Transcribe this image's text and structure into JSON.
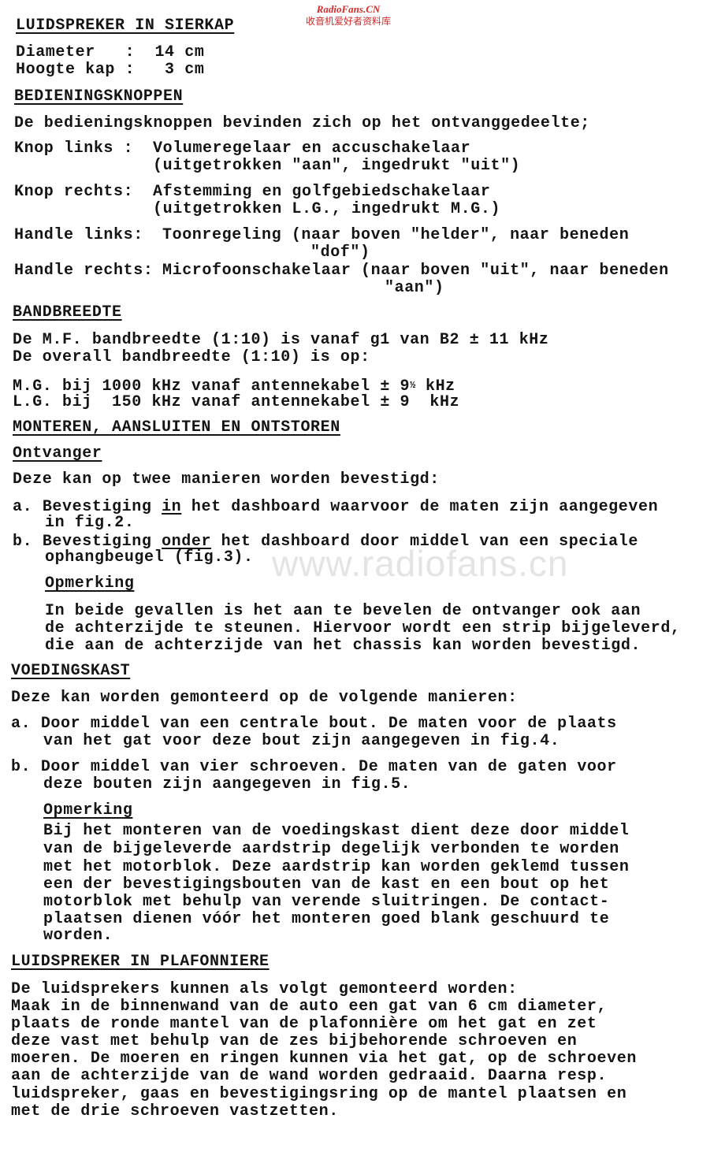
{
  "watermark": {
    "site_en": "RadioFans.CN",
    "site_cn": "收音机爱好者资料库",
    "center_url": "www.radiofans.cn"
  },
  "sections": {
    "sierkap": {
      "heading": "LUIDSPREKER IN SIERKAP",
      "specs": [
        {
          "label": "Diameter   :",
          "value": "14",
          "unit": "cm"
        },
        {
          "label": "Hoogte kap :",
          "value": " 3",
          "unit": "cm"
        }
      ]
    },
    "bediening": {
      "heading": "BEDIENINGSKNOPPEN",
      "intro": "De bedieningsknoppen bevinden zich op het ontvanggedeelte;",
      "controls": [
        {
          "label": "Knop links :",
          "line1": "Volumeregelaar en accuschakelaar",
          "line2": "(uitgetrokken \"aan\", ingedrukt \"uit\")"
        },
        {
          "label": "Knop rechts:",
          "line1": "Afstemming en golfgebiedschakelaar",
          "line2": "(uitgetrokken L.G., ingedrukt M.G.)"
        },
        {
          "label": "Handle links:",
          "line1": "Toonregeling (naar boven \"helder\", naar beneden",
          "line2": "\"dof\")"
        },
        {
          "label": "Handle rechts:",
          "line1": "Microfoonschakelaar (naar boven \"uit\", naar beneden",
          "line2": "\"aan\")"
        }
      ]
    },
    "bandbreedte": {
      "heading": "BANDBREEDTE",
      "line1": "De M.F. bandbreedte (1:10) is vanaf g1 van B2 ± 11 kHz",
      "line2": "De overall bandbreedte (1:10) is op:",
      "rows": [
        {
          "band": "M.G. bij",
          "freq": "1000 kHz",
          "text": "vanaf antennekabel",
          "pm": "±",
          "value": "9",
          "frac": "½",
          "unit": "kHz"
        },
        {
          "band": "L.G. bij",
          "freq": " 150 kHz",
          "text": "vanaf antennekabel",
          "pm": "±",
          "value": "9",
          "frac": "",
          "unit": " kHz"
        }
      ]
    },
    "monteren": {
      "heading": "MONTEREN, AANSLUITEN EN ONTSTOREN",
      "ontvanger": {
        "subheading": "Ontvanger",
        "intro": "Deze kan op twee manieren worden bevestigd:",
        "items": [
          {
            "marker": "a.",
            "pre": "Bevestiging ",
            "em": "in",
            "post": " het dashboard waarvoor de maten zijn aangegeven",
            "cont": "in fig.2."
          },
          {
            "marker": "b.",
            "pre": "Bevestiging ",
            "em": "onder",
            "post": " het dashboard door middel van een speciale",
            "cont": "ophangbeugel (fig.3)."
          }
        ],
        "note_heading": "Opmerking",
        "note_lines": [
          "In beide gevallen is het aan te bevelen de ontvanger ook aan",
          "de achterzijde te steunen. Hiervoor wordt een strip bijgeleverd,",
          "die aan de achterzijde van het chassis kan worden bevestigd."
        ]
      }
    },
    "voedingskast": {
      "heading": "VOEDINGSKAST",
      "intro": "Deze kan worden gemonteerd op de volgende manieren:",
      "items": [
        {
          "marker": "a.",
          "line1": "Door middel van een centrale bout. De maten voor de plaats",
          "line2": "van het gat voor deze bout zijn aangegeven in fig.4."
        },
        {
          "marker": "b.",
          "line1": "Door middel van vier schroeven. De maten van de gaten voor",
          "line2": "deze bouten zijn aangegeven in fig.5."
        }
      ],
      "note_heading": "Opmerking",
      "note_lines": [
        "Bij het monteren van de voedingskast dient deze door middel",
        "van de bijgeleverde aardstrip degelijk verbonden te worden",
        "met het motorblok. Deze aardstrip kan worden geklemd tussen",
        "een der bevestigingsbouten van de kast en een bout op het",
        "motorblok met behulp van verende sluitringen. De contact-",
        "plaatsen dienen vóór het monteren goed blank geschuurd te",
        "worden."
      ]
    },
    "plafonniere": {
      "heading": "LUIDSPREKER IN PLAFONNIERE",
      "lines": [
        "De luidsprekers kunnen als volgt gemonteerd worden:",
        "Maak in de binnenwand van de auto een gat van 6 cm diameter,",
        "plaats de ronde mantel van de plafonnière om het gat en zet",
        "deze vast met behulp van de zes bijbehorende schroeven en",
        "moeren. De moeren en ringen kunnen via het gat, op de schroeven",
        "aan de achterzijde van de wand worden gedraaid. Daarna resp.",
        "luidspreker, gaas en bevestigingsring op de mantel plaatsen en",
        "met de drie schroeven vastzetten."
      ]
    }
  }
}
